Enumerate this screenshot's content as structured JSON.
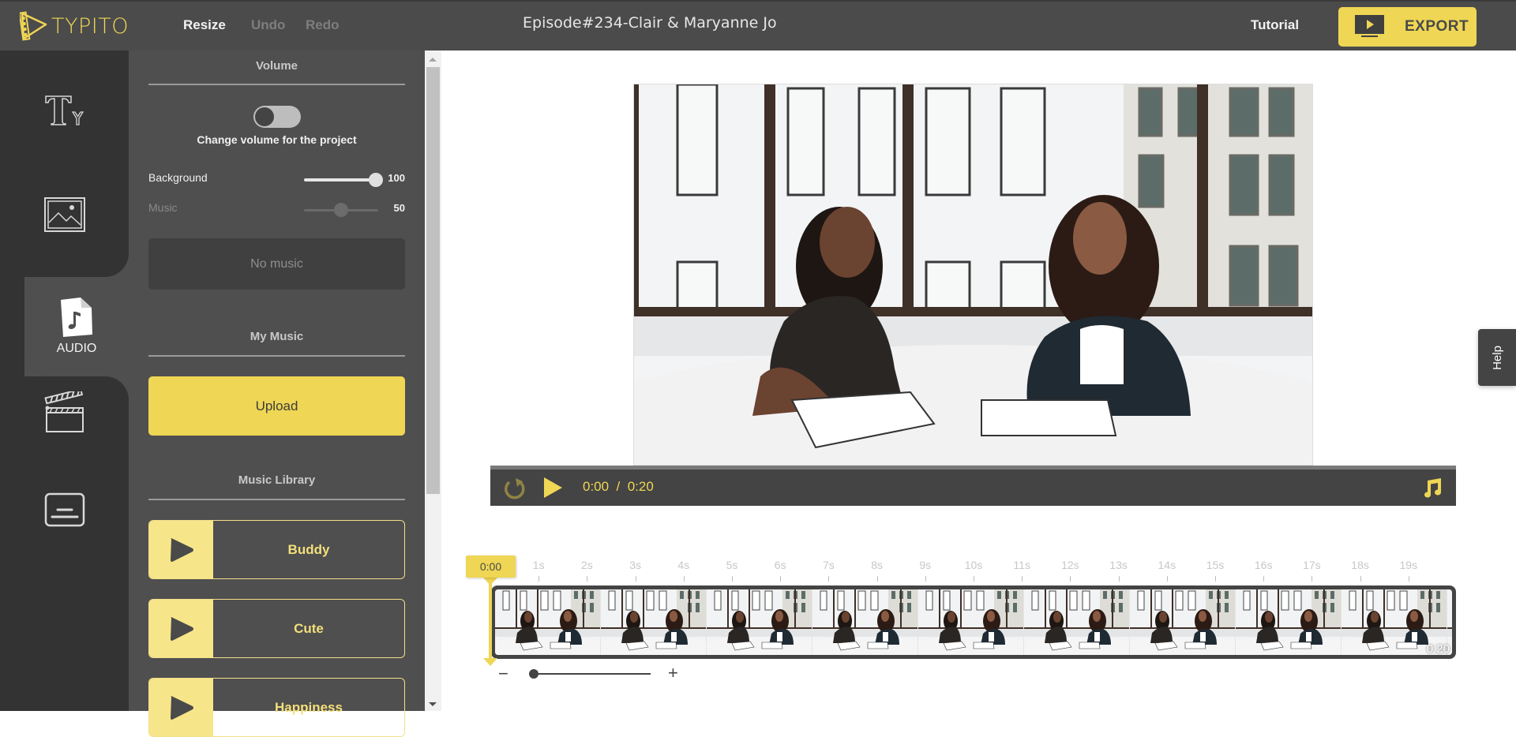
{
  "header": {
    "logo_text": "TYPITO",
    "resize_label": "Resize",
    "undo_label": "Undo",
    "redo_label": "Redo",
    "project_title": "Episode#234-Clair & Maryanne Jo",
    "tutorial_label": "Tutorial",
    "export_label": "EXPORT"
  },
  "rail": {
    "items": [
      {
        "name": "text",
        "icon": "text-icon",
        "label": ""
      },
      {
        "name": "image",
        "icon": "image-icon",
        "label": ""
      },
      {
        "name": "audio",
        "icon": "audio-file-icon",
        "label": "AUDIO",
        "active": true
      },
      {
        "name": "scenes",
        "icon": "clapperboard-icon",
        "label": ""
      },
      {
        "name": "subtitles",
        "icon": "subtitles-icon",
        "label": ""
      }
    ]
  },
  "audio_panel": {
    "volume_title": "Volume",
    "toggle_on": false,
    "toggle_caption": "Change volume for the project",
    "sliders": [
      {
        "label": "Background",
        "value": "100",
        "fraction": 1.0,
        "enabled": true
      },
      {
        "label": "Music",
        "value": "50",
        "fraction": 0.5,
        "enabled": false
      }
    ],
    "no_music_label": "No music",
    "my_music_title": "My Music",
    "upload_label": "Upload",
    "library_title": "Music Library",
    "tracks": [
      {
        "name": "Buddy"
      },
      {
        "name": "Cute"
      },
      {
        "name": "Happiness"
      }
    ]
  },
  "player": {
    "current_time": "0:00",
    "separator": "/",
    "duration": "0:20",
    "time_display": "0:00  /  0:20"
  },
  "help_label": "Help",
  "timeline": {
    "playhead_time": "0:00",
    "tick_labels": [
      "1s",
      "2s",
      "3s",
      "4s",
      "5s",
      "6s",
      "7s",
      "8s",
      "9s",
      "10s",
      "11s",
      "12s",
      "13s",
      "14s",
      "15s",
      "16s",
      "17s",
      "18s",
      "19s"
    ],
    "end_time": "0:20",
    "frame_count": 10,
    "zoom_fraction": 0.0,
    "zoom_out_label": "−",
    "zoom_in_label": "+"
  },
  "colors": {
    "accent": "#efd654",
    "header_bg": "#4b4b4b",
    "rail_bg": "#333333",
    "panel_bg": "#4f4f4f"
  }
}
